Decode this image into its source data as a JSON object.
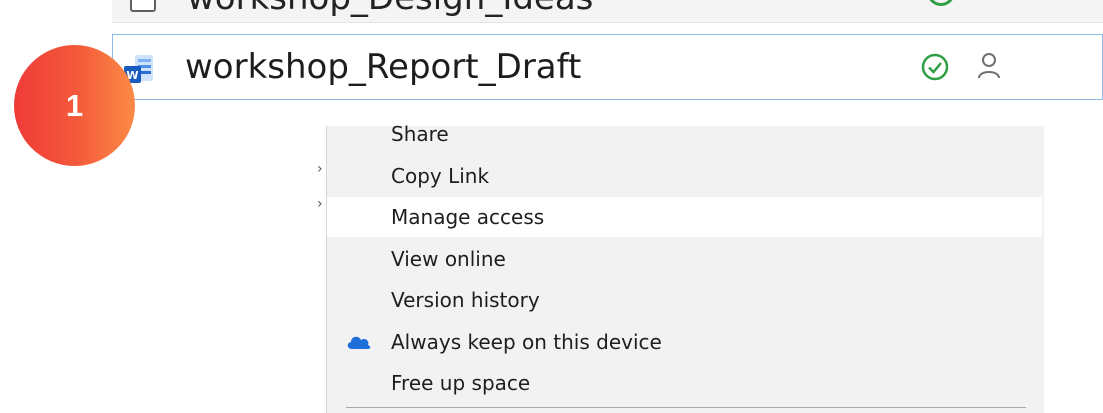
{
  "previous_row": {
    "name": "workshop_Design_Ideas"
  },
  "selected_file": {
    "name": "workshop_Report_Draft",
    "status": "synced"
  },
  "badge": {
    "number": "1"
  },
  "context_menu": {
    "items": [
      {
        "label": "Share"
      },
      {
        "label": "Copy Link"
      },
      {
        "label": "Manage access"
      },
      {
        "label": "View online"
      },
      {
        "label": "Version history"
      },
      {
        "label": "Always keep on this device",
        "icon": "cloud-icon"
      },
      {
        "label": "Free up space"
      }
    ],
    "highlighted_item": "Manage access"
  },
  "colors": {
    "status_green": "#2f9e44",
    "selection_border": "#8fb9e6",
    "onedrive_blue": "#1e6fd9",
    "badge_start": "#ef3b38",
    "badge_end": "#fb8a46"
  }
}
